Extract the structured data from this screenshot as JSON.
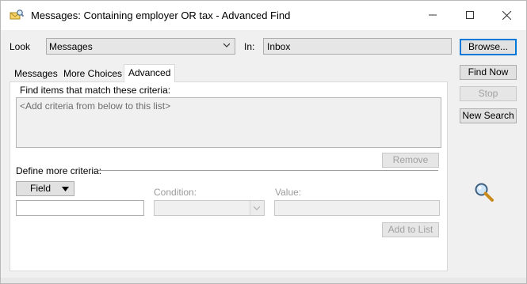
{
  "window": {
    "title": "Messages: Containing employer OR tax - Advanced Find",
    "minimize_glyph": "—",
    "maximize_glyph": "☐",
    "close_glyph": "✕"
  },
  "look": {
    "label": "Look",
    "value": "Messages"
  },
  "in": {
    "label": "In:",
    "value": "Inbox"
  },
  "buttons": {
    "browse": "Browse...",
    "find_now": "Find Now",
    "stop": "Stop",
    "new_search": "New Search",
    "remove": "Remove",
    "add_to_list": "Add to List"
  },
  "tabs": [
    {
      "label": "Messages",
      "active": false
    },
    {
      "label": "More Choices",
      "active": false
    },
    {
      "label": "Advanced",
      "active": true
    }
  ],
  "advanced": {
    "criteria_heading": "Find items that match these criteria:",
    "criteria_placeholder": "<Add criteria from below to this list>",
    "define_more": "Define more criteria:",
    "field_button": "Field",
    "condition_label": "Condition:",
    "value_label": "Value:",
    "field_input_value": "",
    "value_input_value": ""
  },
  "icons": {
    "app": "find-envelope-icon",
    "search": "magnifier-icon"
  },
  "colors": {
    "accent": "#0078d7",
    "dialog_bg": "#f0f0f0",
    "disabled_text": "#a0a0a0"
  }
}
